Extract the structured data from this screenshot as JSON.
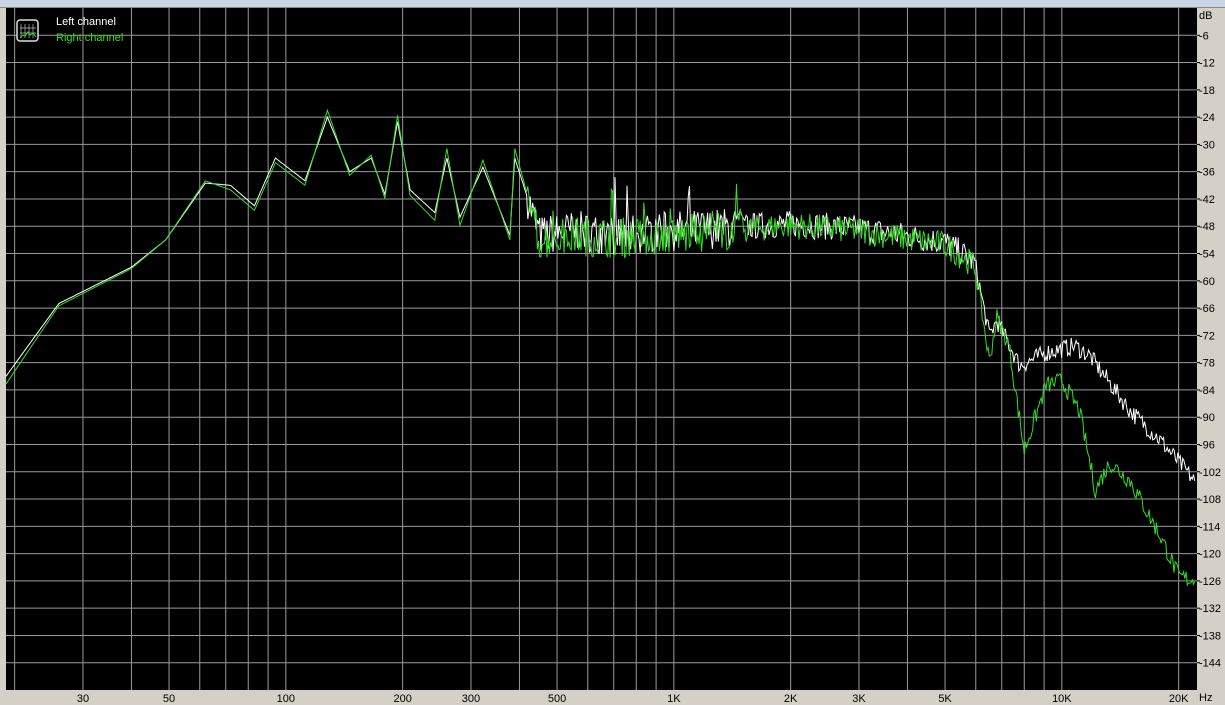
{
  "chart_data": {
    "type": "line",
    "title": "",
    "xlabel": "Hz",
    "ylabel": "dB",
    "xscale": "log",
    "xlim": [
      19,
      22300
    ],
    "ylim": [
      -150,
      0
    ],
    "grid": true,
    "legend_placement": "top-left",
    "x_tick_labels": [
      {
        "v": 30,
        "t": "30"
      },
      {
        "v": 50,
        "t": "50"
      },
      {
        "v": 100,
        "t": "100"
      },
      {
        "v": 200,
        "t": "200"
      },
      {
        "v": 300,
        "t": "300"
      },
      {
        "v": 500,
        "t": "500"
      },
      {
        "v": 1000,
        "t": "1K"
      },
      {
        "v": 2000,
        "t": "2K"
      },
      {
        "v": 3000,
        "t": "3K"
      },
      {
        "v": 5000,
        "t": "5K"
      },
      {
        "v": 10000,
        "t": "10K"
      },
      {
        "v": 20000,
        "t": "20K"
      }
    ],
    "y_ticks": [
      -6,
      -12,
      -18,
      -24,
      -30,
      -36,
      -42,
      -48,
      -54,
      -60,
      -66,
      -72,
      -78,
      -84,
      -90,
      -96,
      -102,
      -108,
      -114,
      -120,
      -126,
      -132,
      -138,
      -144
    ],
    "series": [
      {
        "name": "Left channel",
        "color": "#ffffff",
        "points": [
          [
            19,
            -81
          ],
          [
            26,
            -65
          ],
          [
            40,
            -57
          ],
          [
            49,
            -51
          ],
          [
            62,
            -38.5
          ],
          [
            72,
            -39
          ],
          [
            83,
            -43.5
          ],
          [
            94,
            -33
          ],
          [
            112,
            -38
          ],
          [
            128,
            -24
          ],
          [
            146,
            -36
          ],
          [
            166,
            -33
          ],
          [
            180,
            -41
          ],
          [
            194,
            -25
          ],
          [
            209,
            -40
          ],
          [
            242,
            -45
          ],
          [
            260,
            -33
          ],
          [
            281,
            -46
          ],
          [
            322,
            -35
          ],
          [
            378,
            -50
          ],
          [
            389,
            -33
          ],
          [
            451,
            -50
          ],
          [
            556,
            -49
          ],
          [
            700,
            -50
          ],
          [
            1000,
            -49
          ],
          [
            2000,
            -47.5
          ],
          [
            3000,
            -48.5
          ],
          [
            5000,
            -51.5
          ],
          [
            5970,
            -56
          ],
          [
            6500,
            -72
          ],
          [
            6800,
            -68.8
          ],
          [
            7800,
            -78.7
          ],
          [
            9100,
            -75.8
          ],
          [
            10800,
            -74.3
          ],
          [
            11800,
            -76.5
          ],
          [
            15000,
            -88.6
          ],
          [
            17900,
            -95
          ],
          [
            22000,
            -104
          ]
        ]
      },
      {
        "name": "Right channel",
        "color": "#33dd22",
        "points": [
          [
            19,
            -82.7
          ],
          [
            26,
            -65.5
          ],
          [
            40,
            -57.3
          ],
          [
            49,
            -51
          ],
          [
            62,
            -38
          ],
          [
            72,
            -40
          ],
          [
            83,
            -44.5
          ],
          [
            94,
            -34
          ],
          [
            112,
            -39
          ],
          [
            128,
            -22.5
          ],
          [
            146,
            -36.8
          ],
          [
            166,
            -32.4
          ],
          [
            180,
            -41.9
          ],
          [
            194,
            -23.6
          ],
          [
            209,
            -41.2
          ],
          [
            242,
            -46.7
          ],
          [
            260,
            -30.9
          ],
          [
            281,
            -47.8
          ],
          [
            322,
            -33.5
          ],
          [
            378,
            -51
          ],
          [
            389,
            -30.9
          ],
          [
            451,
            -51
          ],
          [
            556,
            -50
          ],
          [
            700,
            -50.5
          ],
          [
            1000,
            -50
          ],
          [
            2000,
            -47.8
          ],
          [
            3000,
            -49
          ],
          [
            5000,
            -52
          ],
          [
            5970,
            -56.7
          ],
          [
            6500,
            -77.6
          ],
          [
            6800,
            -68
          ],
          [
            7300,
            -74
          ],
          [
            8000,
            -97.4
          ],
          [
            9100,
            -83
          ],
          [
            10000,
            -82
          ],
          [
            11100,
            -88.6
          ],
          [
            12200,
            -106
          ],
          [
            13300,
            -100
          ],
          [
            15000,
            -104
          ],
          [
            17900,
            -116
          ],
          [
            20000,
            -125
          ],
          [
            22000,
            -126
          ]
        ]
      }
    ]
  }
}
